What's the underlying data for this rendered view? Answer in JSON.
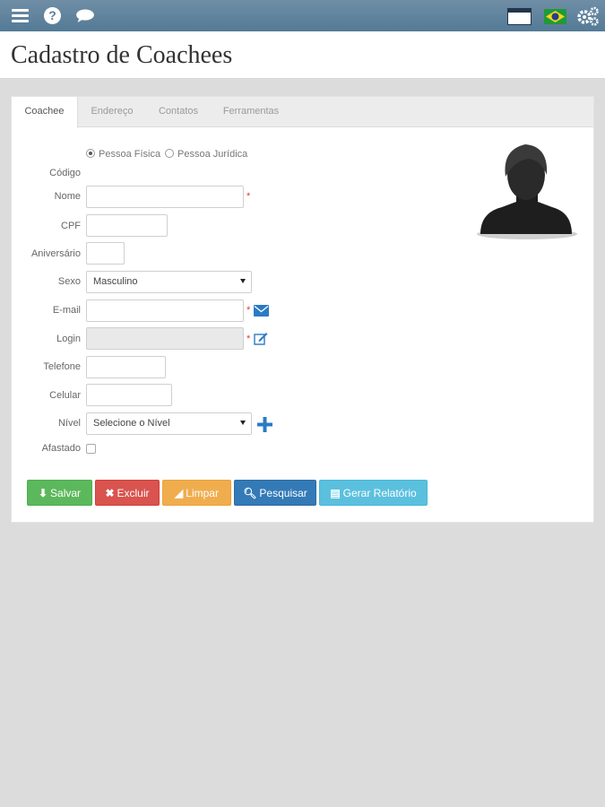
{
  "topbar": {
    "menu_icon": "hamburger-menu-icon",
    "help_icon": "help-icon",
    "help_glyph": "?",
    "chat_icon": "chat-bubble-icon",
    "window_icon": "window-icon",
    "flag_icon": "brazil-flag-icon",
    "settings_icon": "gears-icon",
    "color": "#5f829c"
  },
  "page": {
    "title": "Cadastro de Coachees"
  },
  "tabs": [
    {
      "label": "Coachee",
      "active": true
    },
    {
      "label": "Endereço",
      "active": false
    },
    {
      "label": "Contatos",
      "active": false
    },
    {
      "label": "Ferramentas",
      "active": false
    }
  ],
  "form": {
    "person_type": {
      "options": [
        "Pessoa Física",
        "Pessoa Jurídica"
      ],
      "selected": "Pessoa Física"
    },
    "labels": {
      "codigo": "Código",
      "nome": "Nome",
      "cpf": "CPF",
      "aniversario": "Aniversário",
      "sexo": "Sexo",
      "email": "E-mail",
      "login": "Login",
      "telefone": "Telefone",
      "celular": "Celular",
      "nivel": "Nível",
      "afastado": "Afastado"
    },
    "values": {
      "nome": "",
      "cpf": "",
      "aniversario": "",
      "email": "",
      "login": "",
      "telefone": "",
      "celular": ""
    },
    "sexo_selected": "Masculino",
    "nivel_selected": "Selecione o Nível",
    "required_mark": "*",
    "afastado_checked": false,
    "email_icon": "envelope-icon",
    "login_icon": "edit-icon",
    "nivel_add_icon": "plus-icon",
    "avatar_icon": "user-silhouette-icon"
  },
  "buttons": {
    "salvar": "Salvar",
    "excluir": "Excluir",
    "limpar": "Limpar",
    "pesquisar": "Pesquisar",
    "gerar_relatorio": "Gerar Relatório"
  },
  "colors": {
    "success": "#5cb85c",
    "danger": "#d9534f",
    "warning": "#f0ad4e",
    "primary": "#337ab7",
    "info": "#5bc0de",
    "icon_blue": "#2a7bc4"
  }
}
